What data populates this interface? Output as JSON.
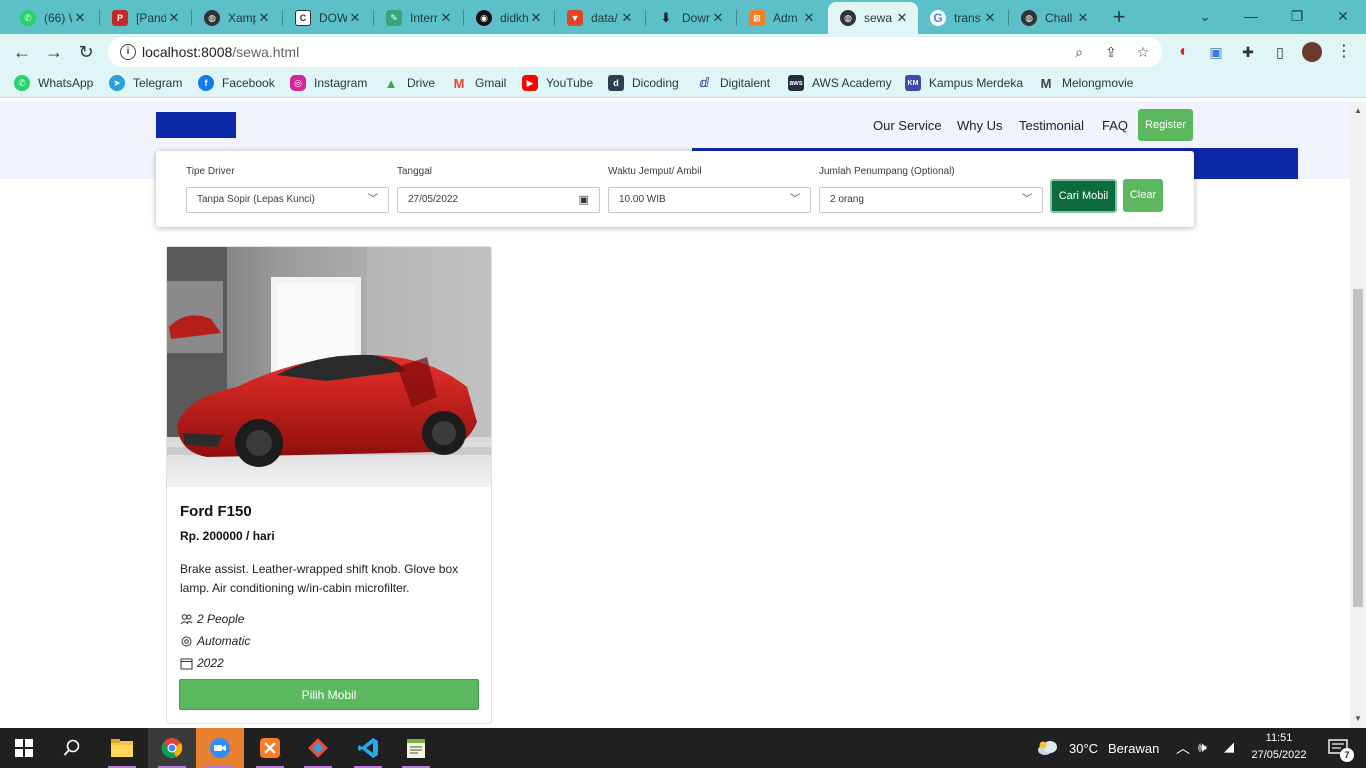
{
  "browser": {
    "tabs": [
      {
        "title": "(66) W",
        "icon": "whatsapp-icon",
        "color": "#25d366"
      },
      {
        "title": "[Pand",
        "icon": "pandas-icon",
        "color": "#c62828"
      },
      {
        "title": "Xamp",
        "icon": "globe-icon",
        "color": "#333333"
      },
      {
        "title": "DOW",
        "icon": "document-icon",
        "color": "#555555"
      },
      {
        "title": "Intern",
        "icon": "feather-icon",
        "color": "#3aa57a"
      },
      {
        "title": "didkh",
        "icon": "github-icon",
        "color": "#111111"
      },
      {
        "title": "data/",
        "icon": "gitlab-icon",
        "color": "#e24329"
      },
      {
        "title": "Dowr",
        "icon": "download-icon",
        "color": "#333333"
      },
      {
        "title": "Adm",
        "icon": "xampp-icon",
        "color": "#fb7a24"
      },
      {
        "title": "sewa",
        "icon": "globe-icon",
        "color": "#333333",
        "active": true
      },
      {
        "title": "trans",
        "icon": "google-icon",
        "color": "#4285f4"
      },
      {
        "title": "Chall",
        "icon": "globe-icon",
        "color": "#333333"
      }
    ],
    "new_tab": "+",
    "url_host": "localhost:8008",
    "url_path": "/sewa.html",
    "bookmarks": [
      {
        "label": "WhatsApp",
        "icon": "whatsapp-icon",
        "color": "#25d366"
      },
      {
        "label": "Telegram",
        "icon": "telegram-icon",
        "color": "#2aa1da"
      },
      {
        "label": "Facebook",
        "icon": "facebook-icon",
        "color": "#1877f2"
      },
      {
        "label": "Instagram",
        "icon": "instagram-icon",
        "color": "#d6249f"
      },
      {
        "label": "Drive",
        "icon": "drive-icon",
        "color": "#34a853"
      },
      {
        "label": "Gmail",
        "icon": "gmail-icon",
        "color": "#ea4335"
      },
      {
        "label": "YouTube",
        "icon": "youtube-icon",
        "color": "#ff0000"
      },
      {
        "label": "Dicoding",
        "icon": "dicoding-icon",
        "color": "#2d3e50"
      },
      {
        "label": "Digitalent",
        "icon": "digitalent-icon",
        "color": "#1d3a8a"
      },
      {
        "label": "AWS Academy",
        "icon": "aws-icon",
        "color": "#232f3e"
      },
      {
        "label": "Kampus Merdeka",
        "icon": "kampus-merdeka-icon",
        "color": "#3e4aa8"
      },
      {
        "label": "Melongmovie",
        "icon": "melongmovie-icon",
        "color": "#444444"
      }
    ]
  },
  "site": {
    "nav": [
      "Our Service",
      "Why Us",
      "Testimonial",
      "FAQ"
    ],
    "register": "Register",
    "search": {
      "driver_label": "Tipe Driver",
      "driver_value": "Tanpa Sopir (Lepas Kunci)",
      "date_label": "Tanggal",
      "date_value": "27/05/2022",
      "time_label": "Waktu Jemput/ Ambil",
      "time_value": "10.00 WIB",
      "passenger_label": "Jumlah Penumpang (Optional)",
      "passenger_value": "2 orang",
      "search_button": "Cari Mobil",
      "clear_button": "Clear"
    },
    "car": {
      "name": "Ford F150",
      "price": "Rp. 200000 / hari",
      "description": "Brake assist. Leather-wrapped shift knob. Glove box lamp. Air conditioning w/in-cabin microfilter.",
      "capacity": "2 People",
      "transmission": "Automatic",
      "year": "2022",
      "button": "Pilih Mobil"
    },
    "colors": {
      "primary_blue": "#0d28a6",
      "green": "#5cb85f",
      "dark_green": "#0d6b3d"
    }
  },
  "taskbar": {
    "weather_temp": "30°C",
    "weather_text": "Berawan",
    "time": "11:51",
    "date": "27/05/2022",
    "notification_count": "7"
  }
}
